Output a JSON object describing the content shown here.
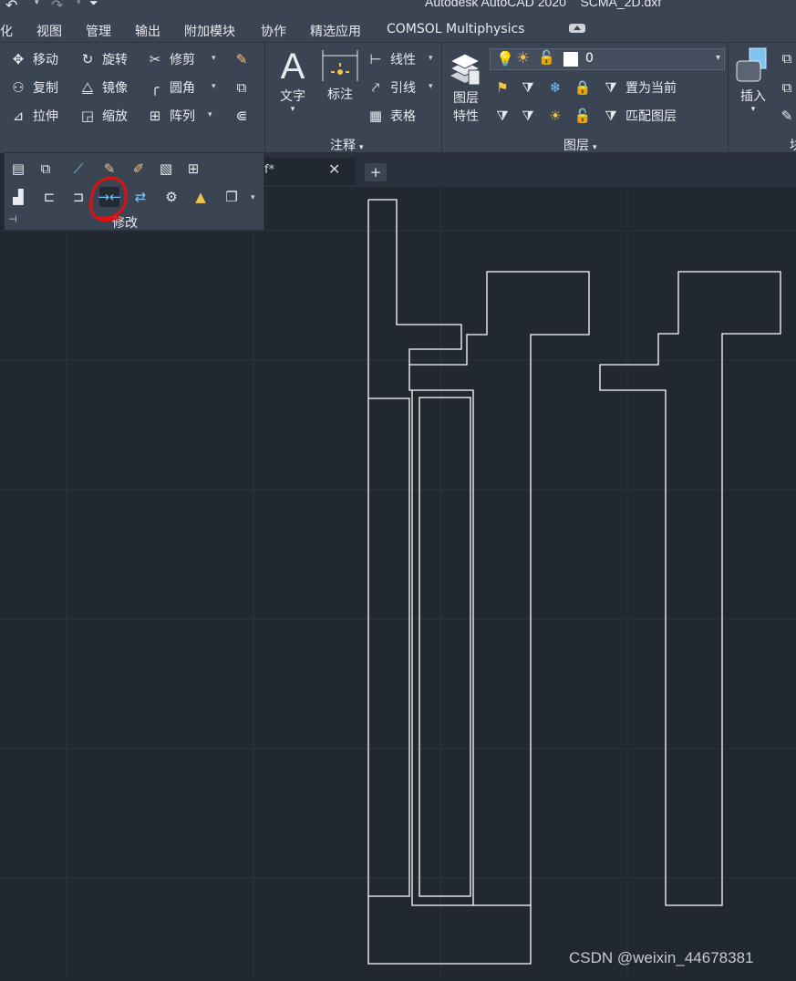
{
  "quick_access": {
    "undo_icon": "undo-icon",
    "redo_icon": "redo-icon",
    "app_title": "Autodesk AutoCAD 2020    SCMA_2D.dxf"
  },
  "menu": {
    "items": [
      "化",
      "视图",
      "管理",
      "输出",
      "附加模块",
      "协作",
      "精选应用",
      "COMSOL Multiphysics"
    ]
  },
  "modify_panel": {
    "tools": {
      "move": "移动",
      "rotate": "旋转",
      "trim": "修剪",
      "copy": "复制",
      "mirror": "镜像",
      "fillet": "圆角",
      "stretch": "拉伸",
      "scale": "缩放",
      "array": "阵列"
    },
    "title": "修改"
  },
  "annotation_panel": {
    "text": "文字",
    "dimension": "标注",
    "linear": "线性",
    "leader": "引线",
    "table": "表格",
    "title": "注释"
  },
  "layers_panel": {
    "layer_properties": "图层",
    "layer_properties_2": "特性",
    "current_layer": "0",
    "current_layer_color": "#ffffff",
    "set_current": "置为当前",
    "match_layer": "匹配图层",
    "title": "图层"
  },
  "block_panel": {
    "insert": "插入",
    "title": "块"
  },
  "doc_tab": {
    "label": "f*",
    "close": "✕",
    "new_tab": "+"
  },
  "highlight": {
    "tool": "join-icon",
    "annotation_color": "#e01010"
  },
  "watermark": "CSDN @weixin_44678381"
}
